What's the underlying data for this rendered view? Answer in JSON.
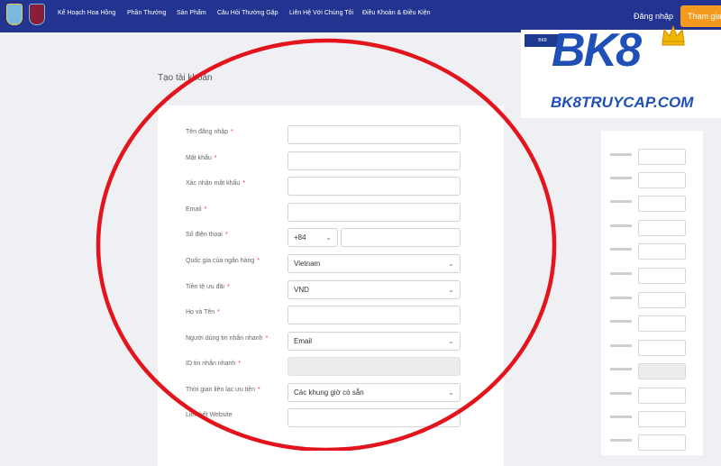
{
  "header": {
    "nav_items": [
      "Kế Hoạch Hoa Hồng",
      "Phần Thưởng",
      "Sản Phẩm",
      "Câu Hỏi Thường Gặp",
      "Liên Hệ Với Chúng Tôi",
      "Điều Khoản & Điều Kiện"
    ],
    "login": "Đăng nhập",
    "join": "Tham gia"
  },
  "page": {
    "title": "Tạo tài khoản"
  },
  "form": {
    "username": {
      "label": "Tên đăng nhập",
      "required": "*"
    },
    "password": {
      "label": "Mật khẩu",
      "required": "*"
    },
    "confirm_password": {
      "label": "Xác nhận mật khẩu",
      "required": "*"
    },
    "email": {
      "label": "Email",
      "required": "*"
    },
    "phone": {
      "label": "Số điện thoại",
      "required": "*",
      "country_code": "+84"
    },
    "bank_country": {
      "label": "Quốc gia của ngân hàng",
      "required": "*",
      "value": "Vietnam"
    },
    "currency": {
      "label": "Tiền tệ ưu đãi",
      "required": "*",
      "value": "VND"
    },
    "full_name": {
      "label": "Họ và Tên",
      "required": "*"
    },
    "messenger": {
      "label": "Người dùng tin nhắn nhanh",
      "required": "*",
      "value": "Email"
    },
    "messenger_id": {
      "label": "ID tin nhắn nhanh",
      "required": "*"
    },
    "contact_time": {
      "label": "Thời gian liên lạc ưu tiên",
      "required": "*",
      "value": "Các khung giờ có sẵn"
    },
    "website": {
      "label": "Liên kết Website"
    }
  },
  "brand": {
    "logo": "BK8",
    "url": "BK8TRUYCAP.COM",
    "mini": "BK8"
  },
  "colors": {
    "header": "#22348f",
    "join_button": "#f39a1f",
    "annotation_circle": "#e3141b",
    "brand_blue": "#1f50b8",
    "crown_gold": "#f2b705"
  }
}
